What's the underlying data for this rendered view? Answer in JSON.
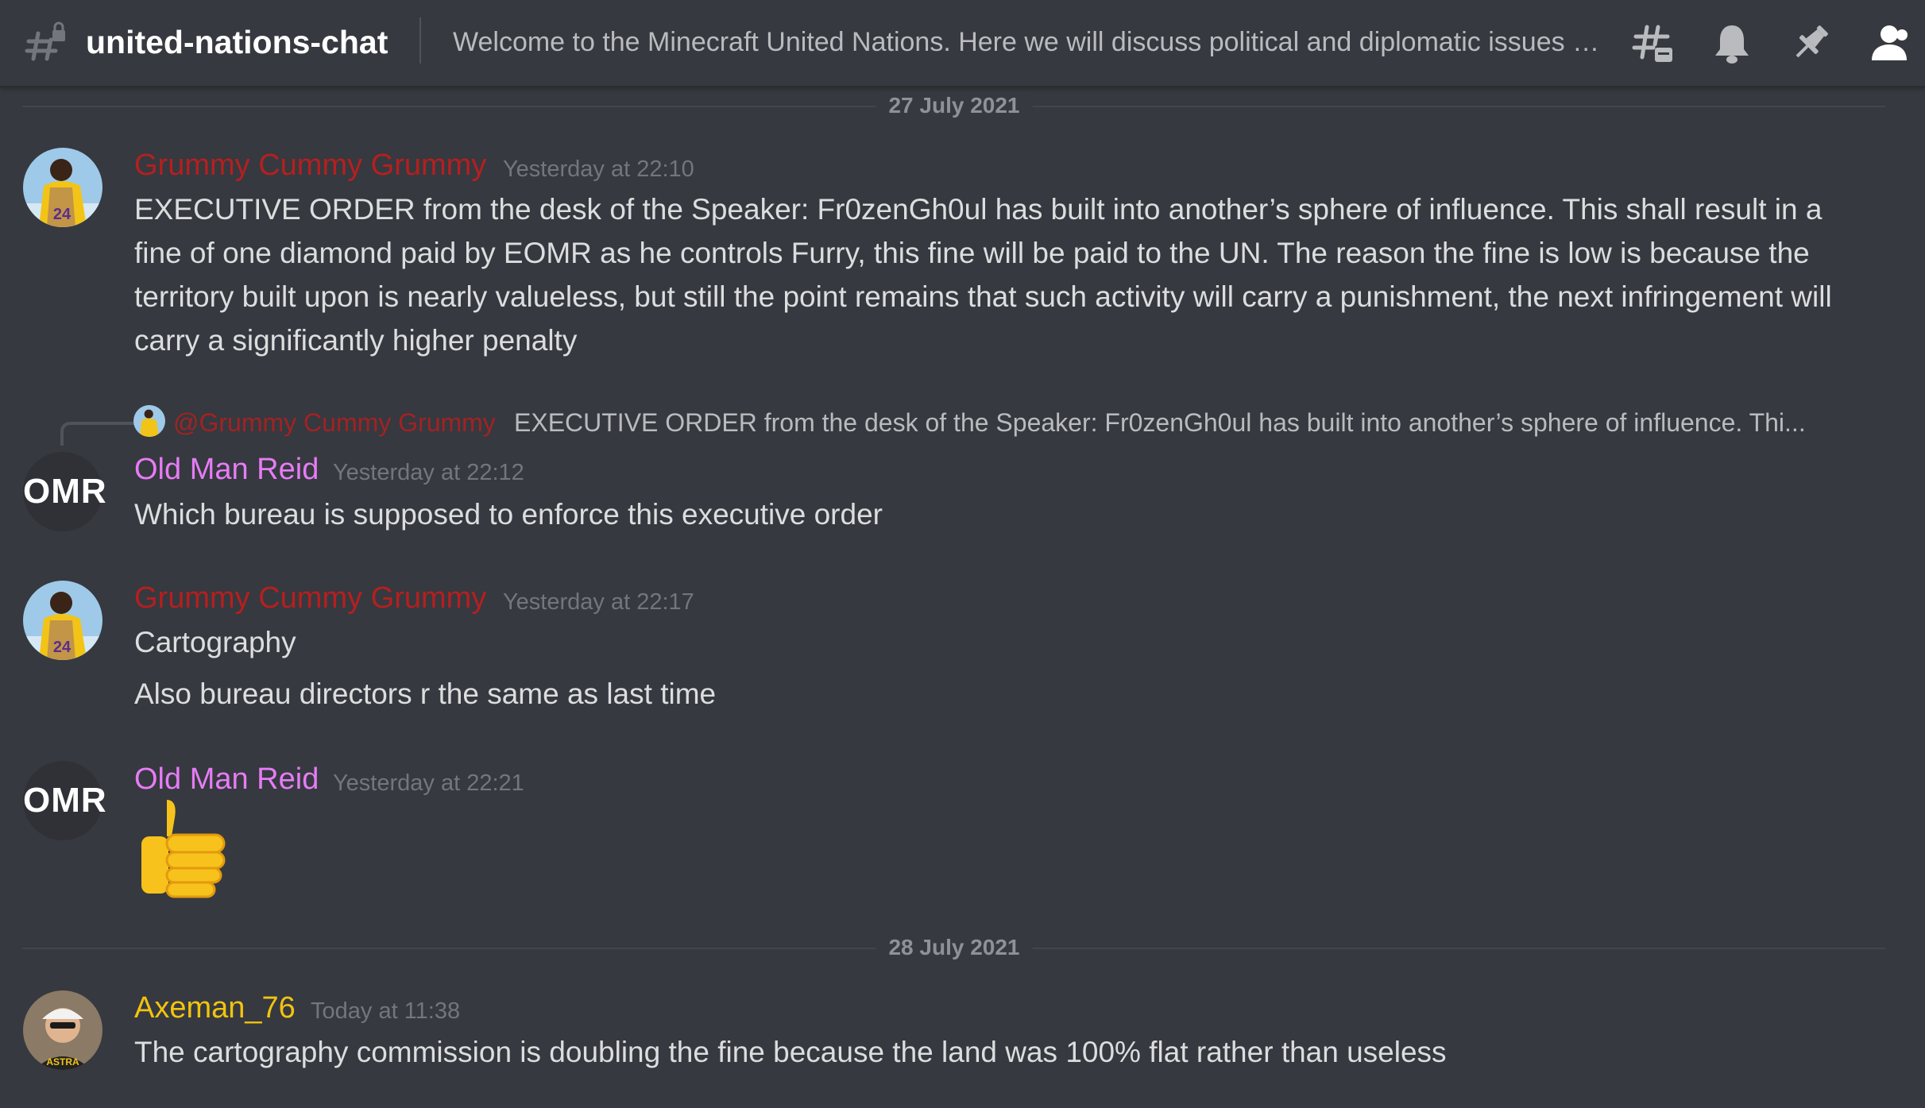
{
  "header": {
    "channel_name": "united-nations-chat",
    "topic": "Welcome to the Minecraft United Nations. Here we will discuss political and diplomatic issues an...",
    "icons": [
      "threads-icon",
      "bell-icon",
      "pin-icon",
      "members-icon"
    ]
  },
  "dates": {
    "first": "27 July 2021",
    "second": "28 July 2021"
  },
  "messages": [
    {
      "author": "Grummy Cummy Grummy",
      "timestamp": "Yesterday at 22:10",
      "text": "EXECUTIVE ORDER from the desk of the Speaker: Fr0zenGh0ul has built into another’s sphere of influence. This shall result in a fine of one diamond paid by EOMR as he controls Furry, this fine will be paid to the UN. The reason the fine is low is because the territory built upon is nearly valueless, but still the point remains that such activity will carry a punishment, the next infringement will carry a significantly higher penalty"
    },
    {
      "reply_author": "@Grummy Cummy Grummy",
      "reply_text": "EXECUTIVE ORDER from the desk of the Speaker: Fr0zenGh0ul has built into another’s sphere of influence. Thi...",
      "avatar_text": "OMR",
      "author": "Old Man Reid",
      "timestamp": "Yesterday at 22:12",
      "text": "Which bureau is supposed to enforce this executive order"
    },
    {
      "author": "Grummy Cummy Grummy",
      "timestamp": "Yesterday at 22:17",
      "text": "Cartography",
      "text2": "Also bureau directors r the same as last time"
    },
    {
      "avatar_text": "OMR",
      "author": "Old Man Reid",
      "timestamp": "Yesterday at 22:21",
      "emoji": "thumbs-up"
    },
    {
      "author": "Axeman_76",
      "timestamp": "Today at 11:38",
      "text": "The cartography commission is doubling the fine because the land was 100% flat rather than useless"
    }
  ],
  "colors": {
    "background": "#36393f",
    "grummy": "#b51f1f",
    "old_man_reid": "#e67cf5",
    "axeman": "#f1c40f"
  }
}
